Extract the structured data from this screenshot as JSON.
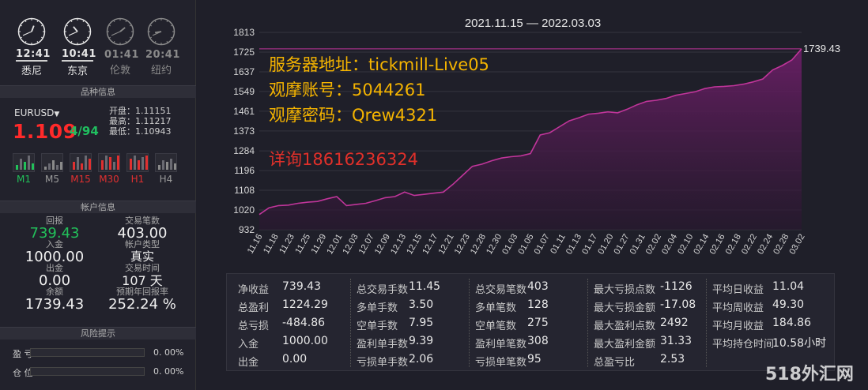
{
  "clocks": [
    {
      "time": "12:41",
      "city": "悉尼",
      "active": true
    },
    {
      "time": "10:41",
      "city": "东京",
      "active": true
    },
    {
      "time": "01:41",
      "city": "伦敦",
      "active": false
    },
    {
      "time": "20:41",
      "city": "纽约",
      "active": false
    }
  ],
  "symbol_section": {
    "header": "品种信息",
    "symbol": "EURUSD",
    "price_big": "1.109",
    "price_small": "4/94",
    "open": "开盘：1.11151",
    "high": "最高：1.11217",
    "low": "最低：1.10943",
    "timeframes": [
      "M1",
      "M5",
      "M15",
      "M30",
      "H1",
      "H4"
    ]
  },
  "account_section": {
    "header": "帐户信息",
    "return_label": "回报",
    "return_value": "739.43",
    "deposit_label": "入金",
    "deposit_value": "1000.00",
    "withdraw_label": "出金",
    "withdraw_value": "0.00",
    "balance_label": "余额",
    "balance_value": "1739.43",
    "trades_label": "交易笔数",
    "trades_value": "403.00",
    "acct_type_label": "帐户类型",
    "acct_type_value": "真实",
    "trade_time_label": "交易时间",
    "trade_time_value": "107 天",
    "annual_label": "预期年回报率",
    "annual_value": "252.24 %"
  },
  "risk_section": {
    "header": "风险提示",
    "profit_label": "盈 亏",
    "profit_pct": "0. 00%",
    "profit_fill": 0,
    "position_label": "仓 位",
    "position_pct": "0. 00%",
    "position_fill": 0
  },
  "overlay": {
    "server": "服务器地址：tickmill-Live05",
    "account": "观摩账号：5044261",
    "password": "观摩密码：Qrew4321",
    "contact": "详询18616236324"
  },
  "chart_data": {
    "type": "area",
    "title": "2021.11.15 — 2022.03.03",
    "ylim": [
      932,
      1813
    ],
    "yticks": [
      932,
      1020,
      1108,
      1196,
      1284,
      1373,
      1461,
      1549,
      1637,
      1725,
      1813
    ],
    "xticks": [
      "11.16",
      "11.18",
      "11.23",
      "11.25",
      "11.29",
      "12.01",
      "12.03",
      "12.07",
      "12.09",
      "12.13",
      "12.15",
      "12.17",
      "12.21",
      "12.23",
      "12.28",
      "12.30",
      "01.03",
      "01.05",
      "01.07",
      "01.11",
      "01.13",
      "01.17",
      "01.20",
      "01.27",
      "01.31",
      "02.02",
      "02.04",
      "02.10",
      "02.14",
      "02.16",
      "02.18",
      "02.22",
      "02.24",
      "02.28",
      "03.02"
    ],
    "last_value_label": "1739.43",
    "values": [
      1000,
      1030,
      1040,
      1042,
      1050,
      1055,
      1058,
      1070,
      1080,
      1040,
      1045,
      1050,
      1062,
      1075,
      1080,
      1100,
      1085,
      1090,
      1095,
      1100,
      1135,
      1175,
      1215,
      1225,
      1240,
      1252,
      1258,
      1262,
      1272,
      1355,
      1365,
      1392,
      1418,
      1432,
      1448,
      1452,
      1458,
      1454,
      1470,
      1490,
      1505,
      1510,
      1518,
      1532,
      1540,
      1548,
      1562,
      1570,
      1572,
      1575,
      1582,
      1592,
      1605,
      1645,
      1665,
      1690,
      1739.43
    ],
    "color": "#c0359a"
  },
  "stats": {
    "col1": [
      [
        "净收益",
        "739.43"
      ],
      [
        "总盈利",
        "1224.29"
      ],
      [
        "总亏损",
        "-484.86"
      ],
      [
        "入金",
        "1000.00"
      ],
      [
        "出金",
        "0.00"
      ]
    ],
    "col2": [
      [
        "总交易手数",
        "11.45"
      ],
      [
        "多单手数",
        "3.50"
      ],
      [
        "空单手数",
        "7.95"
      ],
      [
        "盈利单手数",
        "9.39"
      ],
      [
        "亏损单手数",
        "2.06"
      ]
    ],
    "col3": [
      [
        "总交易笔数",
        "403"
      ],
      [
        "多单笔数",
        "128"
      ],
      [
        "空单笔数",
        "275"
      ],
      [
        "盈利单笔数",
        "308"
      ],
      [
        "亏损单笔数",
        "95"
      ]
    ],
    "col4": [
      [
        "最大亏损点数",
        "-1126"
      ],
      [
        "最大亏损金额",
        "-17.08"
      ],
      [
        "最大盈利点数",
        "2492"
      ],
      [
        "最大盈利金额",
        "31.33"
      ],
      [
        "总盈亏比",
        "2.53"
      ]
    ],
    "col5": [
      [
        "平均日收益",
        "11.04"
      ],
      [
        "平均周收益",
        "49.30"
      ],
      [
        "平均月收益",
        "184.86"
      ],
      [
        "平均持仓时间",
        "10.58小时"
      ]
    ]
  },
  "watermark": "518外汇网"
}
